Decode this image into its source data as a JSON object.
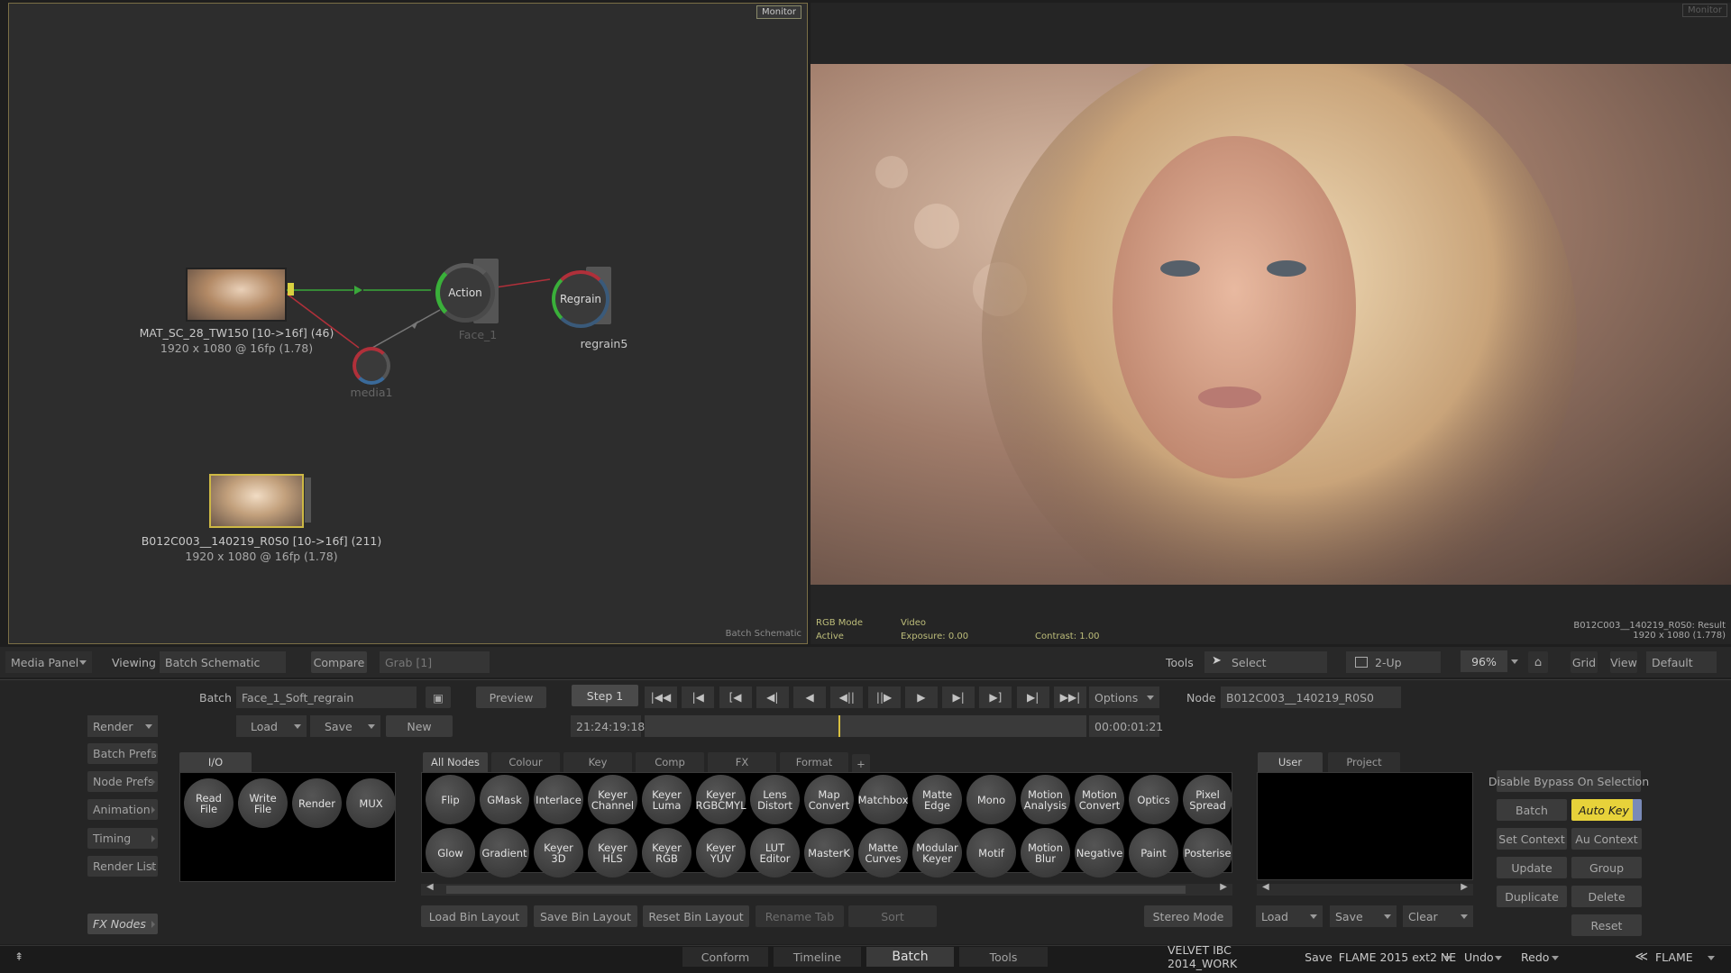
{
  "schematic": {
    "monitor_tag": "Monitor",
    "label": "Batch Schematic",
    "nodes": {
      "read1_name": "MAT_SC_28_TW150 [10->16f] (46)",
      "read1_res": "1920 x 1080 @ 16fp (1.78)",
      "action": "Action",
      "action_sub": "Face_1",
      "regrain": "Regrain",
      "regrain_sub": "regrain5",
      "media": "media1",
      "read2_name": "B012C003__140219_R0S0 [10->16f] (211)",
      "read2_res": "1920 x 1080 @ 16fp (1.78)"
    }
  },
  "viewer": {
    "monitor_tag": "Monitor",
    "info": {
      "rgb_mode": "RGB Mode",
      "active": "Active",
      "video": "Video",
      "exposure": "Exposure: 0.00",
      "contrast": "Contrast: 1.00",
      "clip": "B012C003__140219_R0S0: Result",
      "res": "1920 x 1080 (1.778)"
    }
  },
  "viewbar": {
    "media_panel": "Media Panel",
    "viewing_label": "Viewing",
    "viewing_value": "Batch Schematic",
    "compare": "Compare",
    "grab": "Grab [1]",
    "tools_label": "Tools",
    "select": "Select",
    "layout": "2-Up",
    "zoom": "96%",
    "grid": "Grid",
    "view": "View",
    "default": "Default"
  },
  "batchbar": {
    "batch_label": "Batch",
    "batch_name": "Face_1_Soft_regrain",
    "preview": "Preview",
    "step": "Step 1",
    "options": "Options",
    "node_label": "Node",
    "node_value": "B012C003__140219_R0S0",
    "render": "Render",
    "load": "Load",
    "save": "Save",
    "new": "New",
    "timecode": "21:24:19:18",
    "duration": "00:00:01:21"
  },
  "side_menu": [
    "Batch Prefs",
    "Node Prefs",
    "Animation",
    "Timing",
    "Render List"
  ],
  "fx_nodes": "FX Nodes",
  "io": {
    "tab": "I/O",
    "buttons": [
      "Read\nFile",
      "Write\nFile",
      "Render",
      "MUX"
    ]
  },
  "bins": {
    "tabs": [
      "All Nodes",
      "Colour",
      "Key",
      "Comp",
      "FX",
      "Format",
      "+"
    ],
    "row1": [
      "Flip",
      "GMask",
      "Interlace",
      "Keyer\nChannel",
      "Keyer\nLuma",
      "Keyer\nRGBCMYL",
      "Lens\nDistort",
      "Map\nConvert",
      "Matchbox",
      "Matte\nEdge",
      "Mono",
      "Motion\nAnalysis",
      "Motion\nConvert",
      "Optics",
      "Pixel\nSpread"
    ],
    "row2": [
      "Glow",
      "Gradient",
      "Keyer\n3D",
      "Keyer\nHLS",
      "Keyer\nRGB",
      "Keyer\nYUV",
      "LUT\nEditor",
      "MasterK",
      "Matte\nCurves",
      "Modular\nKeyer",
      "Motif",
      "Motion\nBlur",
      "Negative",
      "Paint",
      "Posterise"
    ],
    "load_layout": "Load Bin Layout",
    "save_layout": "Save Bin Layout",
    "reset_layout": "Reset Bin Layout",
    "rename_tab": "Rename Tab",
    "sort": "Sort",
    "stereo": "Stereo Mode"
  },
  "user_panel": {
    "tabs": [
      "User",
      "Project"
    ],
    "load": "Load",
    "save": "Save",
    "clear": "Clear"
  },
  "right_panel": {
    "disable_bypass": "Disable Bypass On Selection",
    "batch": "Batch",
    "auto_key": "Auto Key",
    "set_context": "Set Context",
    "au_context": "Au Context",
    "update": "Update",
    "group": "Group",
    "duplicate": "Duplicate",
    "delete": "Delete",
    "reset": "Reset"
  },
  "bottom": {
    "tabs": [
      "Conform",
      "Timeline",
      "Batch",
      "Tools"
    ],
    "project": "VELVET IBC 2014_WORK",
    "save": "Save",
    "version": "FLAME 2015 ext2 NE",
    "undo": "Undo",
    "redo": "Redo",
    "app": "FLAME"
  },
  "colors": {
    "auto_key": "#e7d23a",
    "monitor_border": "#7b6f46",
    "link_green": "#3aa83a"
  }
}
